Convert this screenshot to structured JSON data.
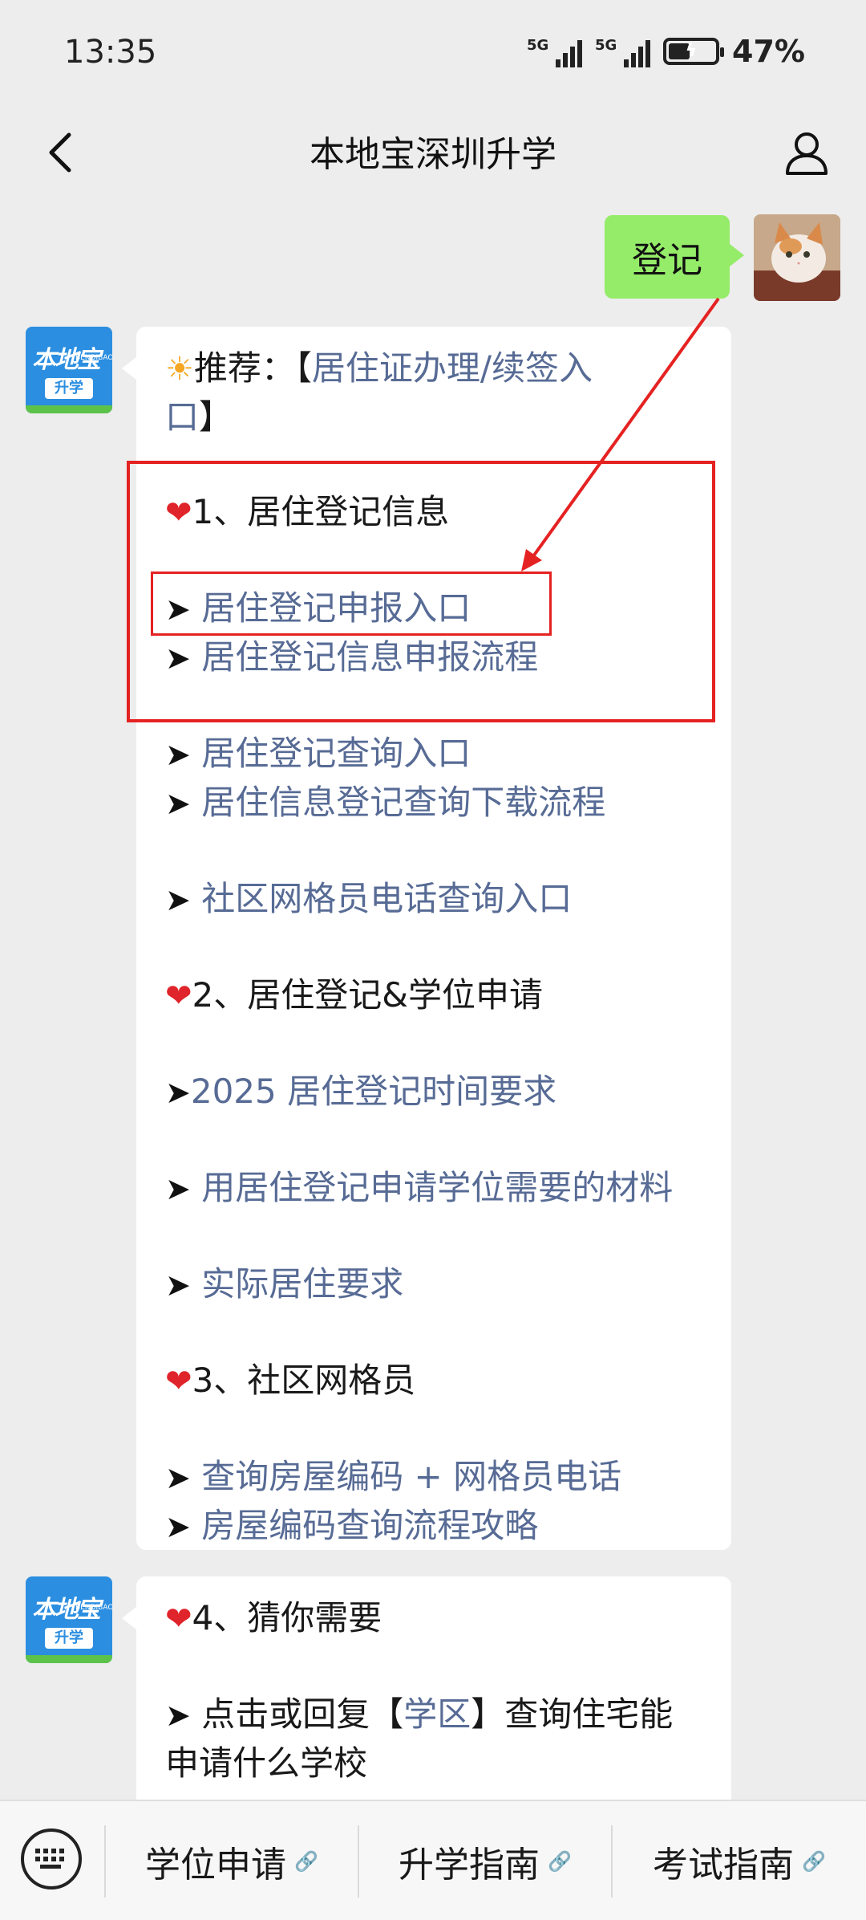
{
  "status": {
    "time": "13:35",
    "signal1": "5G",
    "signal2": "5G",
    "battery_pct": "47%",
    "battery_level": 0.47
  },
  "nav": {
    "title": "本地宝深圳升学"
  },
  "user_message": {
    "text": "登记"
  },
  "bot_avatar": {
    "line1": "本地宝",
    "line2": "BENDIBAO",
    "line3": "升学"
  },
  "msg1": {
    "recommend_prefix": "推荐：【",
    "recommend_link": "居住证办理/续签入",
    "recommend_link2": "口",
    "recommend_suffix": "】",
    "s1_title": "1、居住登记信息",
    "s1_links": [
      "居住登记申报入口",
      "居住登记信息申报流程",
      "居住登记查询入口",
      "居住信息登记查询下载流程",
      "社区网格员电话查询入口"
    ],
    "s2_title": "2、居住登记&学位申请",
    "s2_links": [
      "2025 居住登记时间要求",
      "用居住登记申请学位需要的材料",
      "实际居住要求"
    ],
    "s3_title": "3、社区网格员",
    "s3_links": [
      "查询房屋编码 + 网格员电话",
      "房屋编码查询流程攻略"
    ]
  },
  "msg2": {
    "s4_title": "4、猜你需要",
    "line_prefix": "点击或回复【",
    "line_link": "学区",
    "line_suffix": "】查询住宅能",
    "line2": "申请什么学校"
  },
  "glyphs": {
    "heart": "❤",
    "sun": "☀",
    "arrow": "➤"
  },
  "bottom_menu": [
    "学位申请",
    "升学指南",
    "考试指南"
  ],
  "colors": {
    "link": "#576b95",
    "bubble_green": "#95ec69",
    "highlight_red": "#e52222",
    "heart": "#e0242b"
  }
}
